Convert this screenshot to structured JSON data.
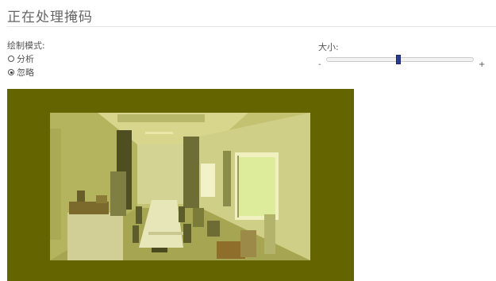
{
  "page": {
    "title": "正在处理掩码"
  },
  "draw_mode": {
    "label": "绘制模式:",
    "options": [
      {
        "label": "分析",
        "selected": false
      },
      {
        "label": "忽略",
        "selected": true
      }
    ]
  },
  "size": {
    "label": "大小:",
    "min_label": "-",
    "max_label": "+",
    "value_fraction": 0.49
  },
  "colors": {
    "mask_overlay": "#656500",
    "slider_thumb": "#2b3b8f"
  }
}
